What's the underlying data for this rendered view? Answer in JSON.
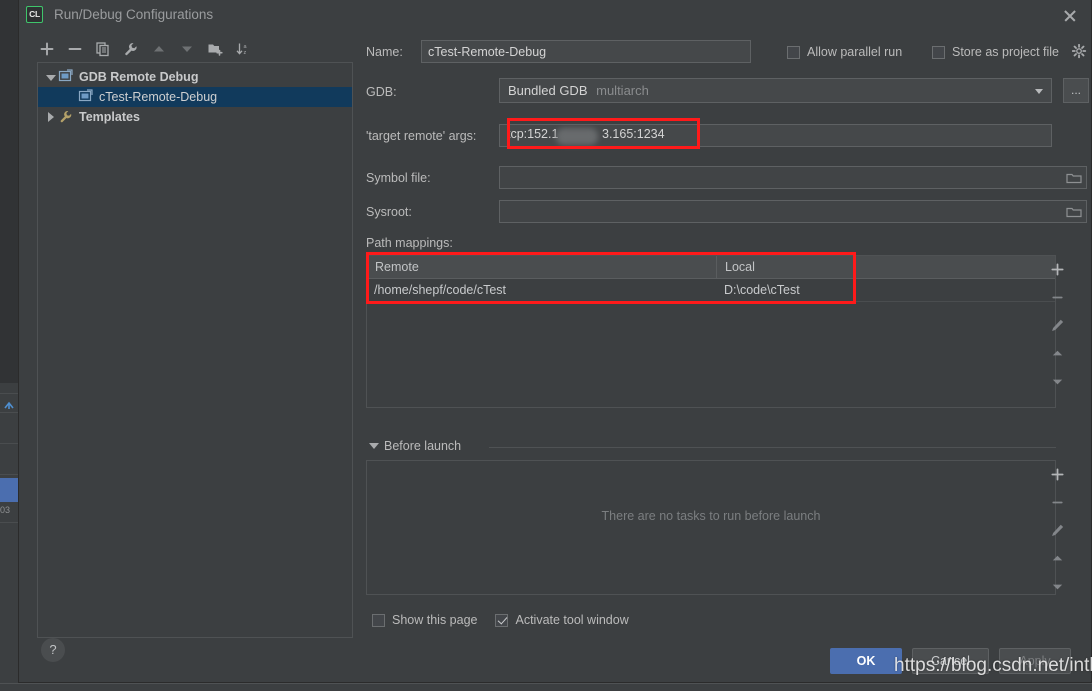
{
  "window": {
    "title": "Run/Debug Configurations",
    "app_icon": "CL",
    "close_icon": "close-icon"
  },
  "toolbar": {
    "buttons": [
      {
        "name": "add-configuration-button",
        "icon": "plus-icon",
        "title": "Add New Configuration"
      },
      {
        "name": "remove-configuration-button",
        "icon": "minus-icon",
        "title": "Remove Configuration"
      },
      {
        "name": "copy-configuration-button",
        "icon": "copy-icon",
        "title": "Copy Configuration"
      },
      {
        "name": "edit-templates-button",
        "icon": "wrench-icon",
        "title": "Edit Templates"
      },
      {
        "name": "move-up-button",
        "icon": "arrow-up-icon",
        "title": "Move Up"
      },
      {
        "name": "move-down-button",
        "icon": "arrow-down-icon",
        "title": "Move Down"
      },
      {
        "name": "new-folder-button",
        "icon": "folder-add-icon",
        "title": "Create New Folder"
      },
      {
        "name": "sort-button",
        "icon": "sort-az-icon",
        "title": "Sort Configurations"
      }
    ]
  },
  "tree": {
    "nodes": [
      {
        "label": "GDB Remote Debug",
        "level": 1,
        "expanded": true,
        "selected": false,
        "icon": "remote-debug-icon"
      },
      {
        "label": "cTest-Remote-Debug",
        "level": 2,
        "expanded": false,
        "selected": true,
        "icon": "remote-debug-icon"
      },
      {
        "label": "Templates",
        "level": 1,
        "expanded": false,
        "selected": false,
        "icon": "wrench-icon"
      }
    ]
  },
  "form": {
    "name_label": "Name:",
    "name_value": "cTest-Remote-Debug",
    "allow_parallel_run": {
      "label": "Allow parallel run",
      "checked": false
    },
    "store_as_project_file": {
      "label": "Store as project file",
      "checked": false,
      "icon": "gear-icon"
    },
    "gdb_label": "GDB:",
    "gdb_value": "Bundled GDB",
    "gdb_value_suffix": "multiarch",
    "gdb_browse_label": "...",
    "target_remote_label": "'target remote' args:",
    "target_remote_value_prefix": "tcp:152.1",
    "target_remote_value_suffix": "3.165:1234",
    "symbol_file_label": "Symbol file:",
    "symbol_file_value": "",
    "sysroot_label": "Sysroot:",
    "sysroot_value": "",
    "path_mappings_label": "Path mappings:"
  },
  "path_mappings": {
    "columns": [
      "Remote",
      "Local"
    ],
    "rows": [
      {
        "remote": "/home/shepf/code/cTest",
        "local": "D:\\code\\cTest"
      }
    ],
    "side_tools": [
      {
        "name": "add-mapping-button",
        "icon": "plus-icon"
      },
      {
        "name": "remove-mapping-button",
        "icon": "minus-icon"
      },
      {
        "name": "edit-mapping-button",
        "icon": "pencil-icon"
      },
      {
        "name": "move-mapping-up-button",
        "icon": "arrow-up-icon"
      },
      {
        "name": "move-mapping-down-button",
        "icon": "arrow-down-icon"
      }
    ]
  },
  "before_launch": {
    "title": "Before launch",
    "expanded": true,
    "empty_message": "There are no tasks to run before launch",
    "side_tools": [
      {
        "name": "add-task-button",
        "icon": "plus-icon"
      },
      {
        "name": "remove-task-button",
        "icon": "minus-icon"
      },
      {
        "name": "edit-task-button",
        "icon": "pencil-icon"
      },
      {
        "name": "move-task-up-button",
        "icon": "arrow-up-icon"
      },
      {
        "name": "move-task-down-button",
        "icon": "arrow-down-icon"
      }
    ]
  },
  "footer": {
    "show_this_page": {
      "label": "Show this page",
      "checked": false
    },
    "activate_tool_window": {
      "label": "Activate tool window",
      "checked": true
    },
    "ok_label": "OK",
    "cancel_label": "Cancel",
    "apply_label": "Apply",
    "help_label": "?"
  },
  "watermark": "https://blog.csdn.net/inthat",
  "annotations": {
    "highlight_color": "#ff1a1a",
    "boxes": [
      {
        "name": "target-remote-args-highlight"
      },
      {
        "name": "path-mappings-highlight"
      }
    ]
  },
  "background": {
    "gutter_line_number": "03"
  },
  "colors": {
    "accent": "#4b6eaf",
    "selection": "#113a5c",
    "panel": "#3c3f41",
    "field": "#45484a",
    "highlight": "#ff1a1a"
  }
}
